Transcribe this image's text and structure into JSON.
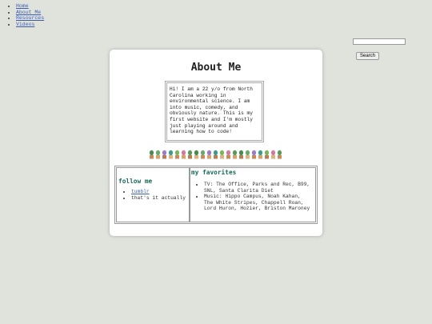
{
  "nav": {
    "items": [
      "Home",
      "About Me",
      "Resources",
      "Videos"
    ]
  },
  "search": {
    "button_label": "Search",
    "value": ""
  },
  "page": {
    "title": "About Me",
    "bio": "Hi! I am a 22 y/o from North Carolina working in environmental science. I am into music, comedy, and obviously nature. This is my first website and I'm mostly just playing around and learning how to code!"
  },
  "follow": {
    "heading": "follow me",
    "link": "tumblr",
    "note": "that's it actually"
  },
  "favorites": {
    "heading": "my favorites",
    "items": [
      "TV: The Office, Parks and Rec, B99, SNL, Santa Clarita Diet",
      "Music: Hippo Campus, Noah Kahan, The White Stripes, Chappell Roan, Lord Huron, Hozier, Briston Maroney"
    ]
  },
  "colors": {
    "background": "#dfe3dc",
    "heading": "#186a5c",
    "link": "#3b5bb5",
    "card": "#ffffff"
  }
}
